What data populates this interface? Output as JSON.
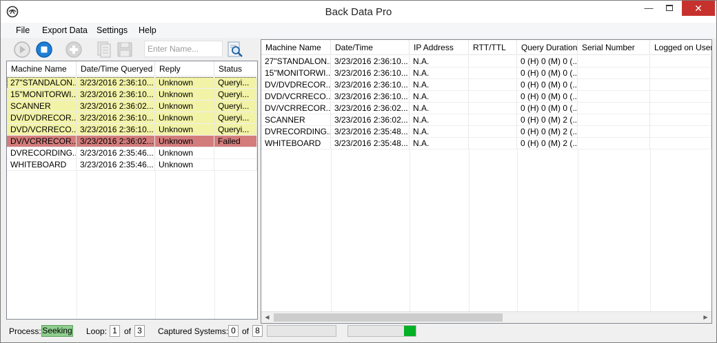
{
  "window": {
    "title": "Back Data Pro"
  },
  "menu": [
    "File",
    "Export Data",
    "Settings",
    "Help"
  ],
  "toolbar": {
    "name_placeholder": "Enter Name..."
  },
  "left_table": {
    "columns": [
      "Machine Name",
      "Date/Time Queryed",
      "Reply",
      "Status"
    ],
    "rows": [
      {
        "cells": [
          "27\"STANDALON...",
          "3/23/2016 2:36:10...",
          "Unknown",
          "Queryi..."
        ],
        "state": "querying"
      },
      {
        "cells": [
          "15\"MONITORWI...",
          "3/23/2016 2:36:10...",
          "Unknown",
          "Queryi..."
        ],
        "state": "querying"
      },
      {
        "cells": [
          "SCANNER",
          "3/23/2016 2:36:02...",
          "Unknown",
          "Queryi..."
        ],
        "state": "querying"
      },
      {
        "cells": [
          "DV/DVDRECOR...",
          "3/23/2016 2:36:10...",
          "Unknown",
          "Queryi..."
        ],
        "state": "querying"
      },
      {
        "cells": [
          "DVD/VCRRECO...",
          "3/23/2016 2:36:10...",
          "Unknown",
          "Queryi..."
        ],
        "state": "querying"
      },
      {
        "cells": [
          "DV/VCRRECOR...",
          "3/23/2016 2:36:02...",
          "Unknown",
          "Failed"
        ],
        "state": "failed"
      },
      {
        "cells": [
          "DVRECORDING...",
          "3/23/2016 2:35:46...",
          "Unknown",
          ""
        ],
        "state": "none"
      },
      {
        "cells": [
          "WHITEBOARD",
          "3/23/2016 2:35:46...",
          "Unknown",
          ""
        ],
        "state": "none"
      }
    ]
  },
  "right_table": {
    "columns": [
      "Machine Name",
      "Date/Time",
      "IP Address",
      "RTT/TTL",
      "Query Duration",
      "Serial Number",
      "Logged on User"
    ],
    "rows": [
      [
        "27\"STANDALON...",
        "3/23/2016 2:36:10...",
        "N.A.",
        "",
        "0 (H) 0 (M) 0 (...",
        "",
        ""
      ],
      [
        "15\"MONITORWI...",
        "3/23/2016 2:36:10...",
        "N.A.",
        "",
        "0 (H) 0 (M) 0 (...",
        "",
        ""
      ],
      [
        "DV/DVDRECOR...",
        "3/23/2016 2:36:10...",
        "N.A.",
        "",
        "0 (H) 0 (M) 0 (...",
        "",
        ""
      ],
      [
        "DVD/VCRRECO...",
        "3/23/2016 2:36:10...",
        "N.A.",
        "",
        "0 (H) 0 (M) 0 (...",
        "",
        ""
      ],
      [
        "DV/VCRRECOR...",
        "3/23/2016 2:36:02...",
        "N.A.",
        "",
        "0 (H) 0 (M) 0 (...",
        "",
        ""
      ],
      [
        "SCANNER",
        "3/23/2016 2:36:02...",
        "N.A.",
        "",
        "0 (H) 0 (M) 2 (...",
        "",
        ""
      ],
      [
        "DVRECORDING...",
        "3/23/2016 2:35:48...",
        "N.A.",
        "",
        "0 (H) 0 (M) 2 (...",
        "",
        ""
      ],
      [
        "WHITEBOARD",
        "3/23/2016 2:35:48...",
        "N.A.",
        "",
        "0 (H) 0 (M) 2 (...",
        "",
        ""
      ]
    ]
  },
  "status": {
    "process_label": "Process:",
    "process_value": "Seeking",
    "loop_label": "Loop:",
    "loop_current": "1",
    "of": "of",
    "loop_total": "3",
    "captured_label": "Captured Systems:",
    "captured_current": "0",
    "captured_total": "8",
    "progress_fraction": 0.17
  },
  "colors": {
    "querying_row": "#f2f3a7",
    "failed_row": "#d37c7c",
    "accent_blue": "#1e7fd6",
    "progress_green": "#06b025"
  }
}
